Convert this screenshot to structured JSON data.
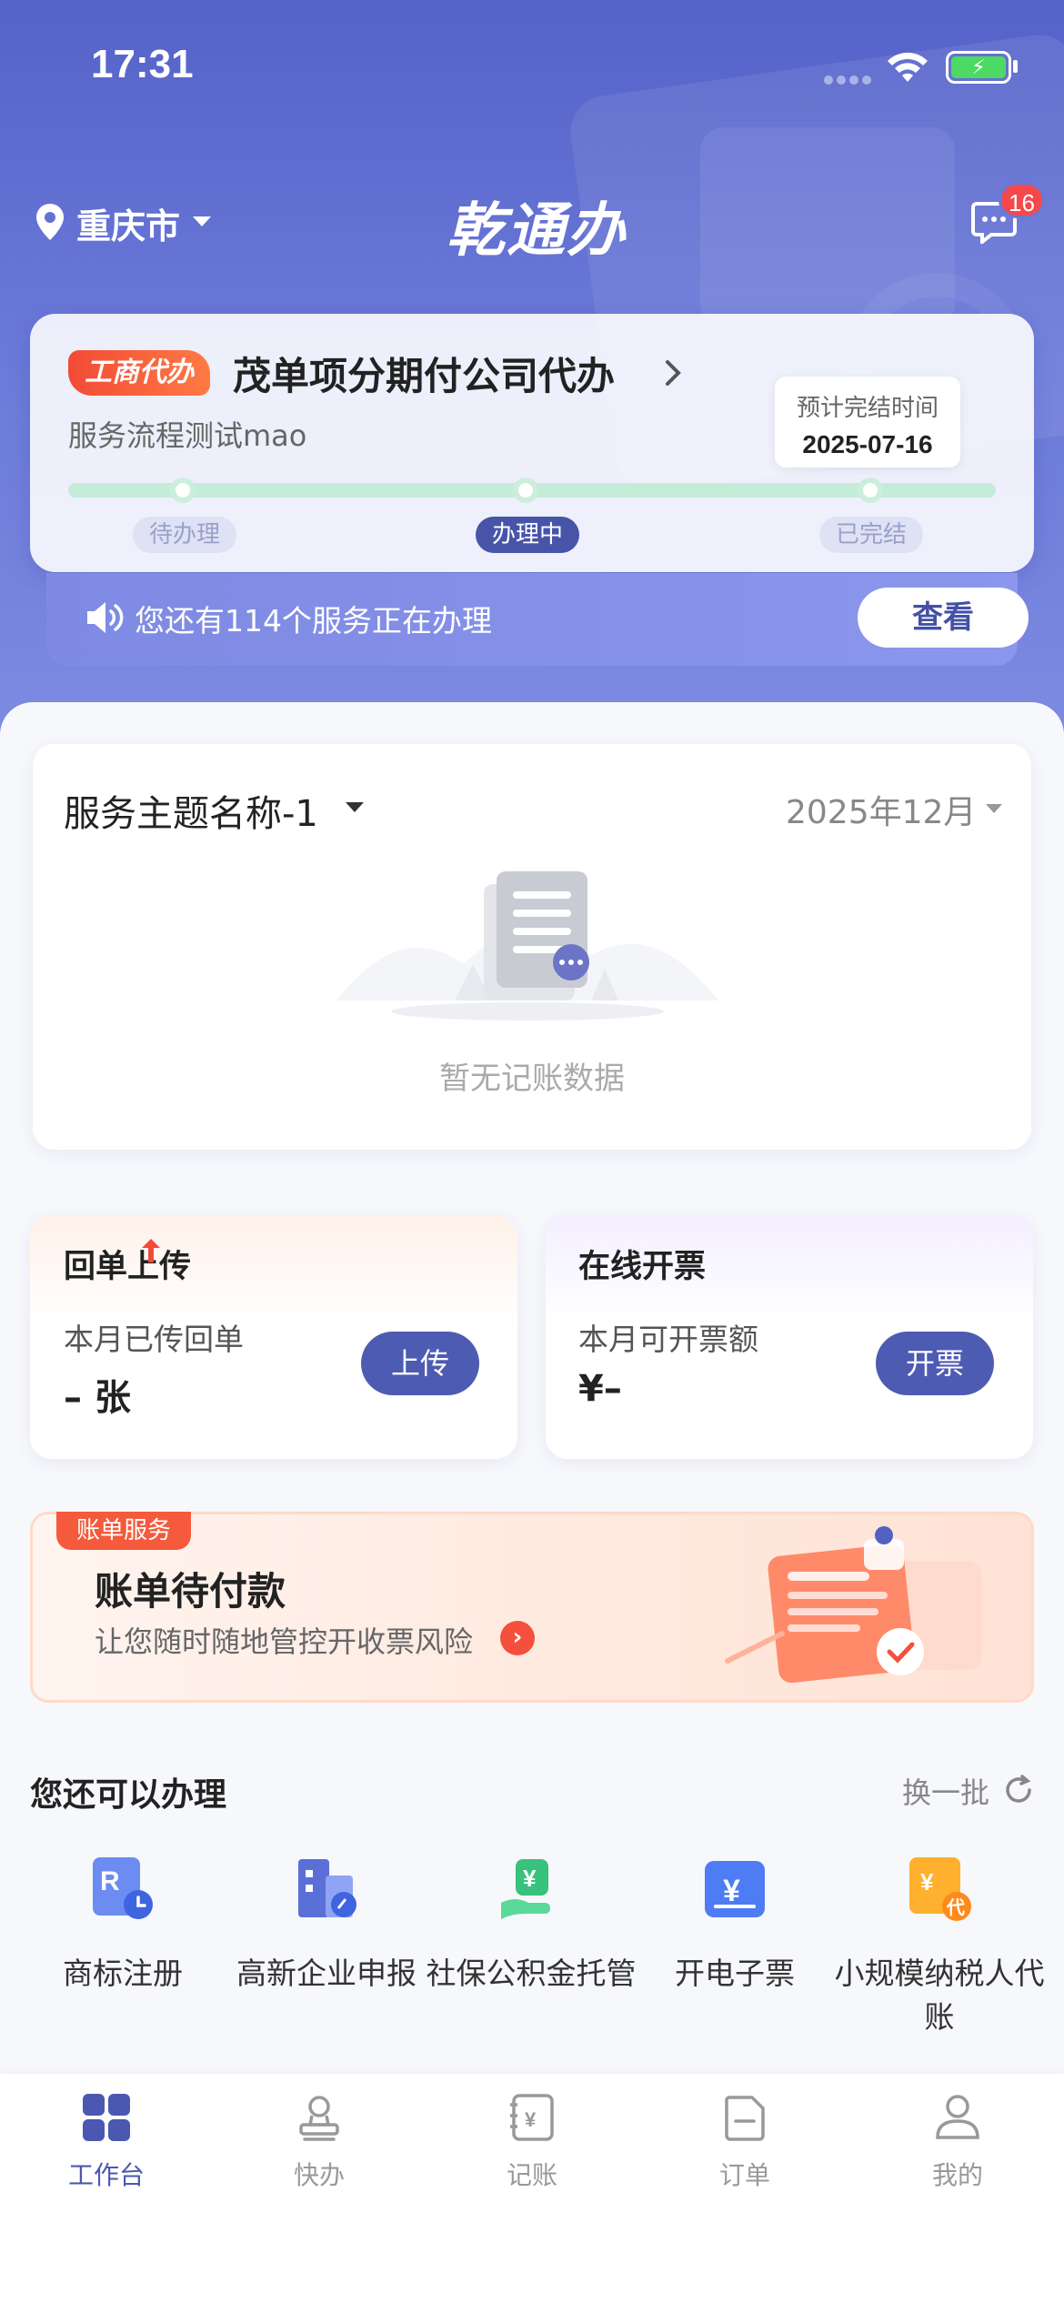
{
  "status_bar": {
    "time": "17:31"
  },
  "header": {
    "location": "重庆市",
    "brand": "乾通办",
    "message_badge": "16"
  },
  "service_card": {
    "tag": "工商代办",
    "title": "茂单项分期付公司代办",
    "subtitle": "服务流程测试mao",
    "eta_label": "预计完结时间",
    "eta_date": "2025-07-16",
    "steps": [
      "待办理",
      "办理中",
      "已完结"
    ],
    "current_step": 1
  },
  "notice": {
    "text": "您还有114个服务正在办理",
    "button": "查看"
  },
  "account": {
    "title": "服务主题名称-1",
    "month": "2025年12月",
    "empty_text": "暂无记账数据"
  },
  "receipt_card": {
    "title": "回单上传",
    "label": "本月已传回单",
    "value": "– 张",
    "button": "上传"
  },
  "invoice_card": {
    "title": "在线开票",
    "label": "本月可开票额",
    "value": "¥–",
    "button": "开票"
  },
  "banner": {
    "tag": "账单服务",
    "title": "账单待付款",
    "subtitle": "让您随时随地管控开收票风险"
  },
  "more": {
    "title": "您还可以办理",
    "refresh": "换一批",
    "items": [
      {
        "label": "商标注册",
        "icon": "trademark-icon"
      },
      {
        "label": "高新企业申报",
        "icon": "enterprise-icon"
      },
      {
        "label": "社保公积金托管",
        "icon": "social-security-icon"
      },
      {
        "label": "开电子票",
        "icon": "e-invoice-icon"
      },
      {
        "label": "小规模纳税人代账",
        "icon": "tax-agent-icon"
      }
    ]
  },
  "tabs": [
    {
      "label": "工作台",
      "icon": "workbench-icon",
      "active": true
    },
    {
      "label": "快办",
      "icon": "quick-icon",
      "active": false
    },
    {
      "label": "记账",
      "icon": "ledger-icon",
      "active": false
    },
    {
      "label": "订单",
      "icon": "order-icon",
      "active": false
    },
    {
      "label": "我的",
      "icon": "profile-icon",
      "active": false
    }
  ],
  "colors": {
    "brand_blue": "#4b58b2",
    "accent_red": "#f45a3b"
  }
}
